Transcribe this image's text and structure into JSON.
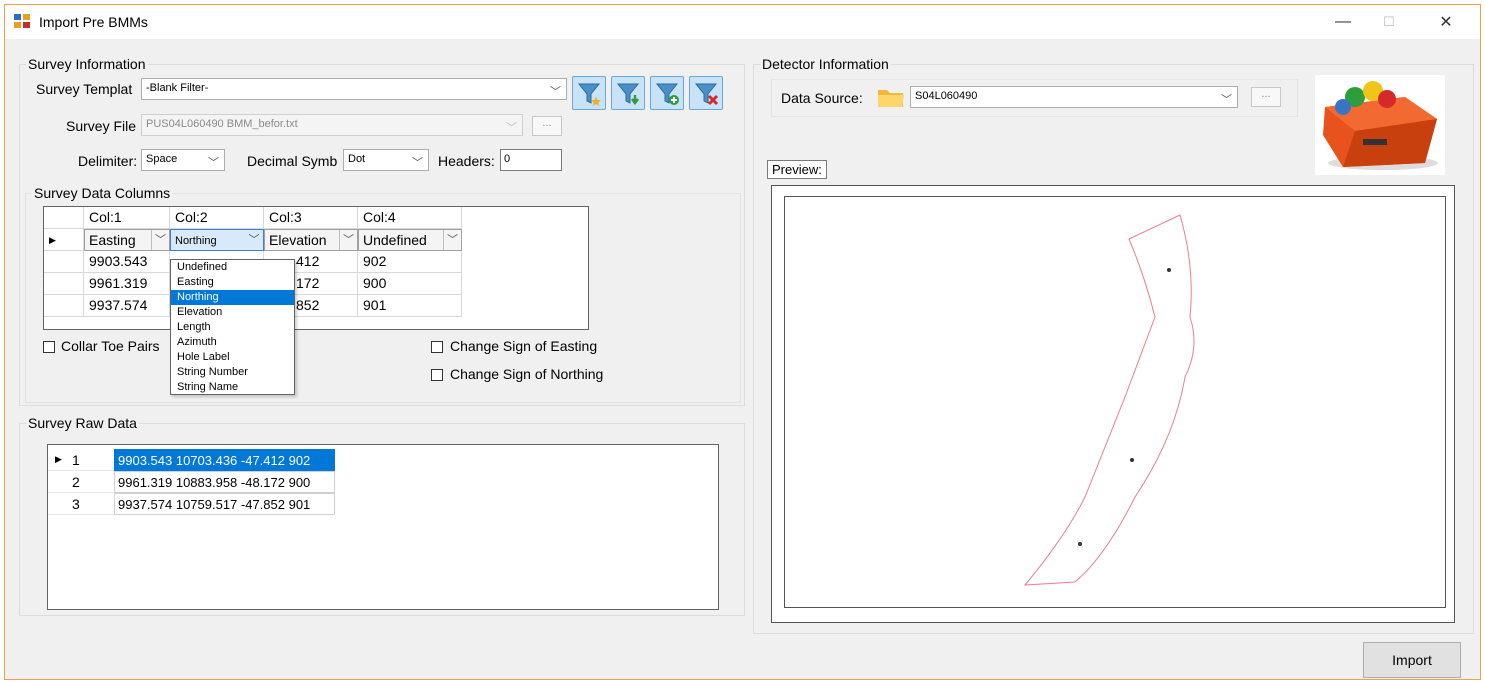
{
  "window": {
    "title": "Import Pre BMMs",
    "minimize": "—",
    "maximize": "☐",
    "close": "✕"
  },
  "survey_info": {
    "group_label": "Survey Information",
    "template_label": "Survey Templat",
    "template_value": "-Blank Filter-",
    "file_label": "Survey File",
    "file_value": "PUS04L060490 BMM_befor.txt",
    "browse_label": "...",
    "delimiter_label": "Delimiter:",
    "delimiter_value": "Space",
    "decimal_label": "Decimal Symb",
    "decimal_value": "Dot",
    "headers_label": "Headers:",
    "headers_value": "0",
    "filter_icons": [
      "filter-star-icon",
      "filter-download-icon",
      "filter-add-icon",
      "filter-delete-icon"
    ]
  },
  "survey_columns": {
    "group_label": "Survey Data Columns",
    "headers": [
      "Col:1",
      "Col:2",
      "Col:3",
      "Col:4"
    ],
    "types": [
      "Easting",
      "Northing",
      "Elevation",
      "Undefined"
    ],
    "rows": [
      [
        "9903.543",
        "",
        "412",
        "902"
      ],
      [
        "9961.319",
        "",
        "172",
        "900"
      ],
      [
        "9937.574",
        "",
        "852",
        "901"
      ]
    ],
    "dropdown_options": [
      "Undefined",
      "Easting",
      "Northing",
      "Elevation",
      "Length",
      "Azimuth",
      "Hole Label",
      "String Number",
      "String Name"
    ],
    "dropdown_selected": "Northing",
    "collar_toe_label": "Collar Toe Pairs",
    "change_easting_label": "Change Sign of Easting",
    "change_northing_label": "Change Sign of Northing"
  },
  "raw_data": {
    "group_label": "Survey Raw Data",
    "rows": [
      {
        "num": "1",
        "value": "9903.543 10703.436 -47.412 902"
      },
      {
        "num": "2",
        "value": "9961.319 10883.958 -48.172 900"
      },
      {
        "num": "3",
        "value": "9937.574 10759.517 -47.852 901"
      }
    ]
  },
  "detector": {
    "group_label": "Detector Information",
    "source_label": "Data Source:",
    "source_value": "S04L060490",
    "browse_label": "...",
    "preview_label": "Preview:"
  },
  "actions": {
    "import_label": "Import"
  }
}
